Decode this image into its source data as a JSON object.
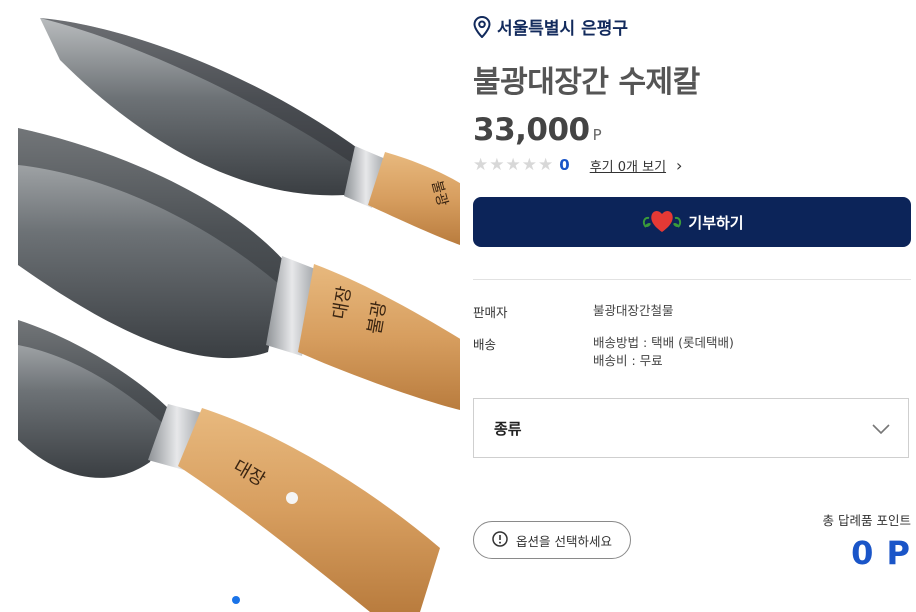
{
  "product": {
    "location": "서울특별시 은평구",
    "title": "불광대장간 수제칼",
    "price": "33,000",
    "price_unit": "P",
    "rating_count": "0",
    "review_link": "후기 0개 보기",
    "donate_label": "기부하기",
    "seller_label": "판매자",
    "seller_value": "불광대장간철물",
    "shipping_label": "배송",
    "shipping_method": "배송방법 : 택배 (롯데택배)",
    "shipping_fee": "배송비 : 무료",
    "option_label": "종류",
    "option_notice": "옵션을 선택하세요",
    "points_label": "총 답례품 포인트",
    "points_value": "0 P"
  },
  "colors": {
    "navy": "#0c2459",
    "link_blue": "#1a55c8",
    "star_inactive": "#d8d8d8"
  },
  "icons": {
    "location": "location-pin-icon",
    "heart": "heart-icon",
    "chevron_down": "chevron-down-icon",
    "chevron_right": "chevron-right-icon",
    "info": "info-icon"
  },
  "carousel": {
    "active_slide": 1,
    "slides": 1
  }
}
